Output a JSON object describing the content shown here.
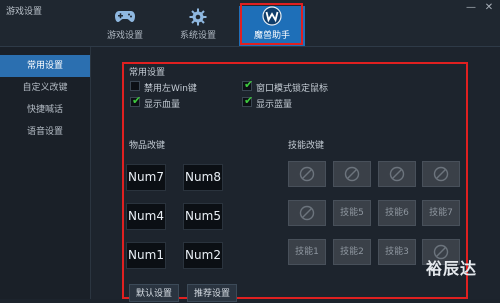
{
  "window": {
    "title": "游戏设置",
    "min_glyph": "—",
    "close_glyph": "✕"
  },
  "topnav": {
    "tabs": [
      {
        "label": "游戏设置",
        "icon": "gamepad-icon"
      },
      {
        "label": "系统设置",
        "icon": "gear-icon"
      },
      {
        "label": "魔兽助手",
        "icon": "warcraft-logo-icon",
        "active": true
      }
    ]
  },
  "sidebar": {
    "items": [
      {
        "label": "常用设置",
        "active": true
      },
      {
        "label": "自定义改键"
      },
      {
        "label": "快捷喊话"
      },
      {
        "label": "语音设置"
      }
    ]
  },
  "common": {
    "section_label": "常用设置",
    "options": [
      {
        "label": "禁用左Win键",
        "checked": false
      },
      {
        "label": "窗口模式锁定鼠标",
        "checked": true
      },
      {
        "label": "显示血量",
        "checked": true
      },
      {
        "label": "显示蓝量",
        "checked": true
      }
    ]
  },
  "items": {
    "section_label": "物品改键",
    "keys": [
      "Num7",
      "Num8",
      "Num4",
      "Num5",
      "Num1",
      "Num2"
    ]
  },
  "skills": {
    "section_label": "技能改键",
    "slots": [
      "",
      "",
      "",
      "",
      "",
      "技能5",
      "技能6",
      "技能7",
      "技能1",
      "技能2",
      "技能3",
      ""
    ]
  },
  "buttons": {
    "default_label": "默认设置",
    "recommended_label": "推荐设置"
  },
  "watermark": "裕辰达",
  "colors": {
    "accent": "#1e6fb8",
    "highlight_box": "#e02020",
    "check": "#3ecc3e"
  }
}
